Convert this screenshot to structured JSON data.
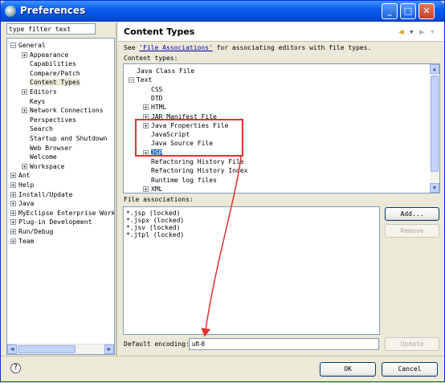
{
  "window": {
    "title": "Preferences",
    "minimize_label": "_",
    "maximize_label": "□",
    "close_label": "✕"
  },
  "filter": {
    "value": "type filter text"
  },
  "nav_tree": [
    {
      "label": "General",
      "expander": "−",
      "level": 0
    },
    {
      "label": "Appearance",
      "expander": "+",
      "level": 1
    },
    {
      "label": "Capabilities",
      "expander": "",
      "level": 1
    },
    {
      "label": "Compare/Patch",
      "expander": "",
      "level": 1
    },
    {
      "label": "Content Types",
      "expander": "",
      "level": 1,
      "selected": true
    },
    {
      "label": "Editors",
      "expander": "+",
      "level": 1
    },
    {
      "label": "Keys",
      "expander": "",
      "level": 1
    },
    {
      "label": "Network Connections",
      "expander": "+",
      "level": 1
    },
    {
      "label": "Perspectives",
      "expander": "",
      "level": 1
    },
    {
      "label": "Search",
      "expander": "",
      "level": 1
    },
    {
      "label": "Startup and Shutdown",
      "expander": "",
      "level": 1
    },
    {
      "label": "Web Browser",
      "expander": "",
      "level": 1
    },
    {
      "label": "Welcome",
      "expander": "",
      "level": 1
    },
    {
      "label": "Workspace",
      "expander": "+",
      "level": 1
    },
    {
      "label": "Ant",
      "expander": "+",
      "level": 0
    },
    {
      "label": "Help",
      "expander": "+",
      "level": 0
    },
    {
      "label": "Install/Update",
      "expander": "+",
      "level": 0
    },
    {
      "label": "Java",
      "expander": "+",
      "level": 0
    },
    {
      "label": "MyEclipse Enterprise Work",
      "expander": "+",
      "level": 0
    },
    {
      "label": "Plug-in Development",
      "expander": "+",
      "level": 0
    },
    {
      "label": "Run/Debug",
      "expander": "+",
      "level": 0
    },
    {
      "label": "Team",
      "expander": "+",
      "level": 0
    }
  ],
  "page": {
    "title": "Content Types",
    "description_prefix": "See ",
    "description_link": "'File Associations'",
    "description_suffix": " for associating editors with file types.",
    "content_types_label": "Content types:",
    "file_associations_label": "File associations:",
    "default_encoding_label": "Default encoding:",
    "default_encoding_value": "uft-8"
  },
  "content_types": [
    {
      "label": "Java Class File",
      "expander": "",
      "level": 0
    },
    {
      "label": "Text",
      "expander": "−",
      "level": 0
    },
    {
      "label": "CSS",
      "expander": "",
      "level": 1
    },
    {
      "label": "DTD",
      "expander": "",
      "level": 1
    },
    {
      "label": "HTML",
      "expander": "+",
      "level": 1
    },
    {
      "label": "JAR Manifest File",
      "expander": "+",
      "level": 1
    },
    {
      "label": "Java Properties File",
      "expander": "+",
      "level": 1
    },
    {
      "label": "JavaScript",
      "expander": "",
      "level": 1
    },
    {
      "label": "Java Source File",
      "expander": "",
      "level": 1
    },
    {
      "label": "JSP",
      "expander": "+",
      "level": 1,
      "selected": true
    },
    {
      "label": "Refactoring History File",
      "expander": "",
      "level": 1
    },
    {
      "label": "Refactoring History Index",
      "expander": "",
      "level": 1
    },
    {
      "label": "Runtime log files",
      "expander": "",
      "level": 1
    },
    {
      "label": "XML",
      "expander": "+",
      "level": 1
    }
  ],
  "file_associations": [
    "*.jsp (locked)",
    "*.jspx (locked)",
    "*.jsv (locked)",
    "*.jtpl (locked)"
  ],
  "buttons": {
    "add": "Add...",
    "remove": "Remove",
    "update": "Update",
    "ok": "OK",
    "cancel": "Cancel",
    "help": "?"
  },
  "icons": {
    "back": "◀",
    "back_menu": "▾",
    "forward": "▶",
    "forward_menu": "▾",
    "scroll_left": "◀",
    "scroll_right": "▶",
    "scroll_up": "▲",
    "scroll_down": "▼"
  },
  "colors": {
    "highlight_box": "#e53030",
    "selection": "#316ac5"
  }
}
